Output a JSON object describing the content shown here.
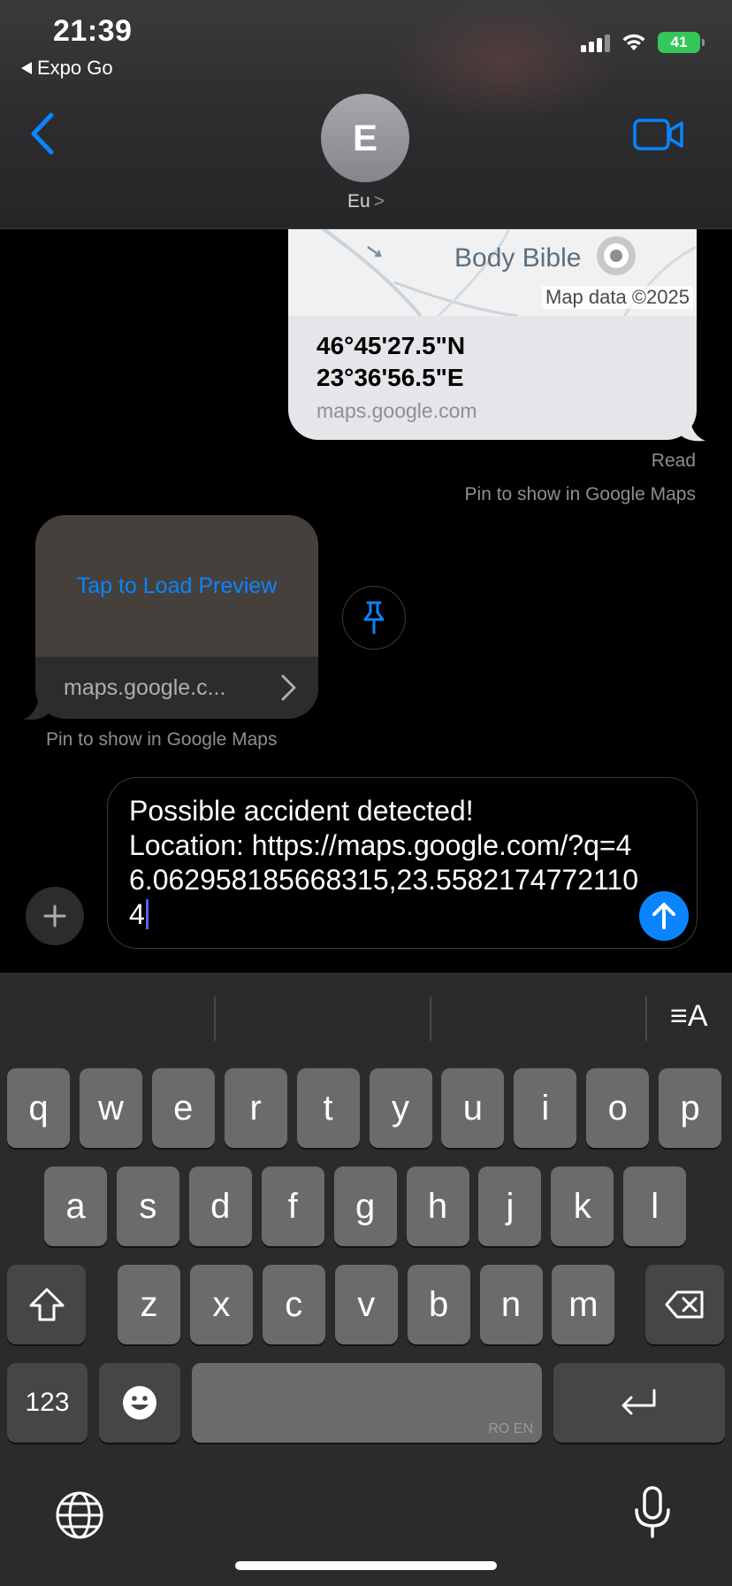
{
  "status_bar": {
    "time": "21:39",
    "back_app": "Expo Go",
    "battery": "41"
  },
  "header": {
    "avatar_initial": "E",
    "contact_name": "Eu",
    "contact_chevron": ">"
  },
  "messages": {
    "outgoing_location": {
      "map_place_label": "Body Bible",
      "map_copyright": "Map data ©2025",
      "coord_line_1": "46°45'27.5\"N",
      "coord_line_2": "23°36'56.5\"E",
      "domain": "maps.google.com",
      "read_receipt": "Read",
      "pin_hint": "Pin to show in Google Maps"
    },
    "incoming_link": {
      "tap_to_load": "Tap to Load Preview",
      "url": "maps.google.c...",
      "pin_hint": "Pin to show in Google Maps"
    }
  },
  "composer": {
    "text": "Possible accident detected!\nLocation: https://maps.google.com/?q=46.062958185668315,23.55821747721104"
  },
  "keyboard": {
    "format_icon": "≡A",
    "row1": [
      "q",
      "w",
      "e",
      "r",
      "t",
      "y",
      "u",
      "i",
      "o",
      "p"
    ],
    "row2": [
      "a",
      "s",
      "d",
      "f",
      "g",
      "h",
      "j",
      "k",
      "l"
    ],
    "row3": [
      "z",
      "x",
      "c",
      "v",
      "b",
      "n",
      "m"
    ],
    "numbers_key": "123",
    "space_languages": "RO EN"
  },
  "colors": {
    "accent_blue": "#0a84ff",
    "battery_green": "#34c759",
    "caret_purple": "#5e5ce6"
  },
  "icons": {
    "back": "chevron-left-icon",
    "video": "video-camera-icon",
    "pin": "pin-icon",
    "plus": "plus-icon",
    "send": "arrow-up-icon",
    "shift": "shift-icon",
    "delete": "delete-backward-icon",
    "emoji": "emoji-icon",
    "return": "return-icon",
    "globe": "globe-icon",
    "mic": "microphone-icon"
  }
}
